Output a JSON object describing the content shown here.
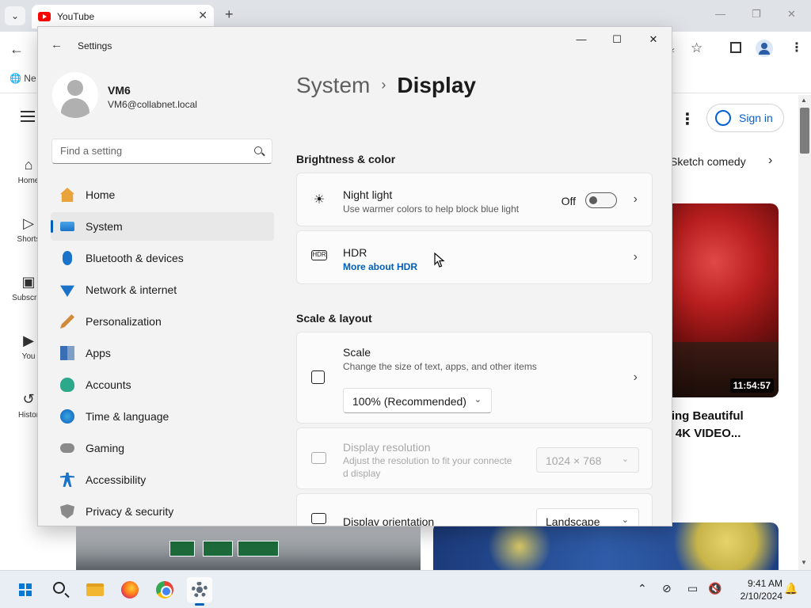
{
  "browser": {
    "tab_title": "YouTube",
    "bookmark_label": "Ne",
    "yt_sidebar": [
      {
        "label": "Home",
        "icon": "home-icon"
      },
      {
        "label": "Shorts",
        "icon": "shorts-icon"
      },
      {
        "label": "Subscript",
        "icon": "subscriptions-icon"
      },
      {
        "label": "You",
        "icon": "you-icon"
      },
      {
        "label": "Histor",
        "icon": "history-icon"
      }
    ],
    "signin_label": "Sign in",
    "chip_text": "Sketch comedy",
    "video": {
      "duration": "11:54:57",
      "title": "azing Beautiful\nc | 4K VIDEO..."
    }
  },
  "settings": {
    "window_title": "Settings",
    "user": {
      "name": "VM6",
      "email": "VM6@collabnet.local"
    },
    "search_placeholder": "Find a setting",
    "nav": [
      {
        "label": "Home",
        "icon": "home-icon",
        "active": false
      },
      {
        "label": "System",
        "icon": "system-icon",
        "active": true
      },
      {
        "label": "Bluetooth & devices",
        "icon": "bluetooth-icon",
        "active": false
      },
      {
        "label": "Network & internet",
        "icon": "network-icon",
        "active": false
      },
      {
        "label": "Personalization",
        "icon": "personalization-icon",
        "active": false
      },
      {
        "label": "Apps",
        "icon": "apps-icon",
        "active": false
      },
      {
        "label": "Accounts",
        "icon": "accounts-icon",
        "active": false
      },
      {
        "label": "Time & language",
        "icon": "time-language-icon",
        "active": false
      },
      {
        "label": "Gaming",
        "icon": "gaming-icon",
        "active": false
      },
      {
        "label": "Accessibility",
        "icon": "accessibility-icon",
        "active": false
      },
      {
        "label": "Privacy & security",
        "icon": "privacy-icon",
        "active": false
      }
    ],
    "breadcrumb": {
      "parent": "System",
      "current": "Display"
    },
    "sections": {
      "brightness": "Brightness & color",
      "scale": "Scale & layout"
    },
    "night_light": {
      "title": "Night light",
      "desc": "Use warmer colors to help block blue light",
      "state": "Off"
    },
    "hdr": {
      "title": "HDR",
      "link": "More about HDR"
    },
    "scale": {
      "title": "Scale",
      "desc": "Change the size of text, apps, and other items",
      "value": "100% (Recommended)"
    },
    "resolution": {
      "title": "Display resolution",
      "desc_line1": "Adjust the resolution to fit your connecte",
      "desc_line2": "d display",
      "value": "1024 × 768"
    },
    "orientation": {
      "title": "Display orientation",
      "value": "Landscape"
    }
  },
  "taskbar": {
    "time": "9:41 AM",
    "date": "2/10/2024",
    "apps": [
      "start",
      "search",
      "file-explorer",
      "firefox",
      "chrome",
      "settings"
    ],
    "accent": "#005fb8"
  }
}
